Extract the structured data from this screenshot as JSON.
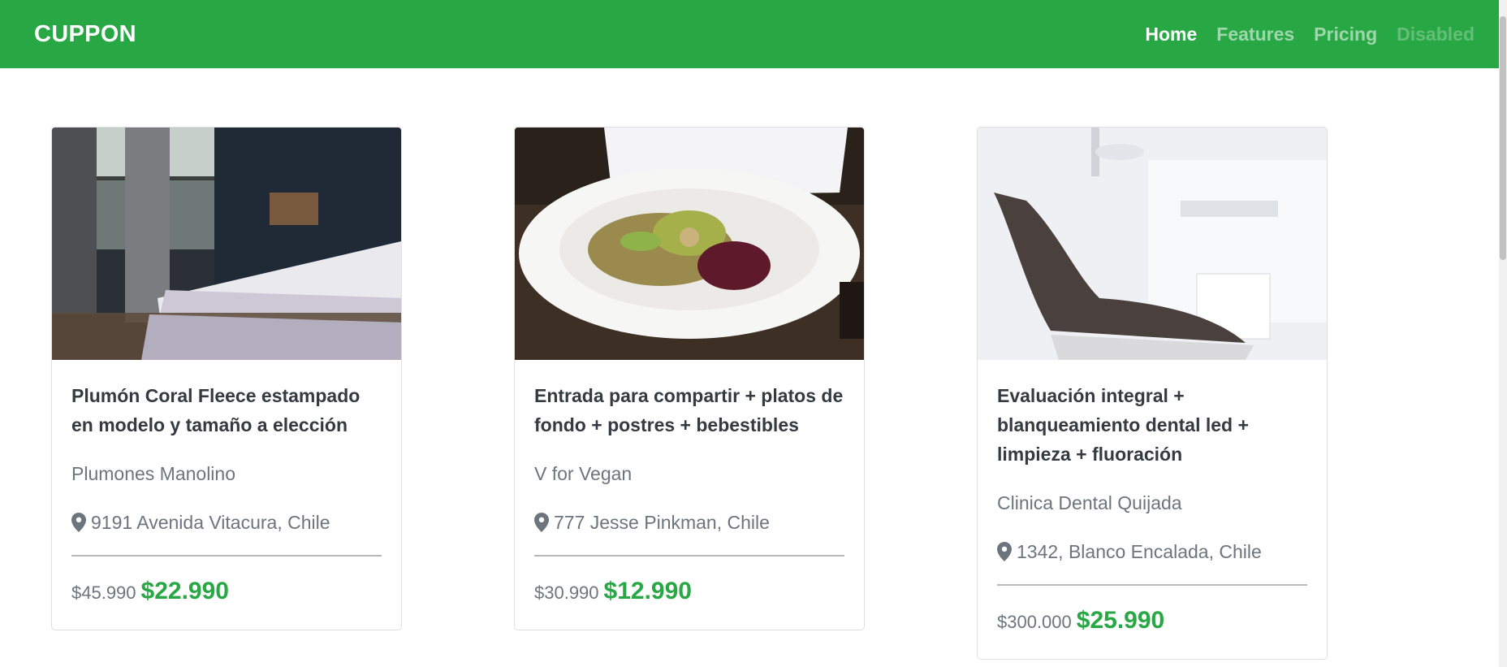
{
  "navbar": {
    "brand": "CUPPON",
    "links": [
      {
        "label": "Home"
      },
      {
        "label": "Features"
      },
      {
        "label": "Pricing"
      },
      {
        "label": "Disabled"
      }
    ]
  },
  "colors": {
    "primary": "#28a745",
    "price": "#28a745",
    "muted": "#6c757d"
  },
  "icons": {
    "location": "map-marker-icon"
  },
  "cards": [
    {
      "image": "bedroom-photo",
      "title": "Plumón Coral Fleece estampado en modelo y tamaño a elección",
      "merchant": "Plumones Manolino",
      "location": "9191 Avenida Vitacura, Chile",
      "old_price": "$45.990",
      "new_price": "$22.990"
    },
    {
      "image": "salad-photo",
      "title": "Entrada para compartir + platos de fondo + postres + bebestibles",
      "merchant": "V for Vegan",
      "location": "777 Jesse Pinkman, Chile",
      "old_price": "$30.990",
      "new_price": "$12.990"
    },
    {
      "image": "dental-chair-photo",
      "title": "Evaluación integral + blanqueamiento dental led + limpieza + fluoración",
      "merchant": "Clinica Dental Quijada",
      "location": "1342, Blanco Encalada, Chile",
      "old_price": "$300.000",
      "new_price": "$25.990"
    }
  ]
}
